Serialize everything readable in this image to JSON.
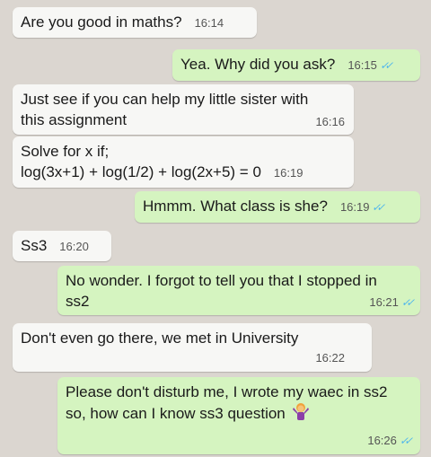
{
  "messages": [
    {
      "id": "m1",
      "direction": "incoming",
      "text": "Are you good in maths?",
      "time": "16:14"
    },
    {
      "id": "m2",
      "direction": "outgoing",
      "text": "Yea. Why did you ask?",
      "time": "16:15",
      "status": "read"
    },
    {
      "id": "m3",
      "direction": "incoming",
      "text": "Just see if you can help my little sister with this assignment",
      "time": "16:16"
    },
    {
      "id": "m4",
      "direction": "incoming",
      "line1": "Solve for x if;",
      "line2": "log(3x+1) + log(1/2) + log(2x+5) = 0",
      "time": "16:19"
    },
    {
      "id": "m5",
      "direction": "outgoing",
      "text": "Hmmm. What class is she?",
      "time": "16:19",
      "status": "read"
    },
    {
      "id": "m6",
      "direction": "incoming",
      "text": "Ss3",
      "time": "16:20"
    },
    {
      "id": "m7",
      "direction": "outgoing",
      "text": "No wonder. I forgot to tell you that I stopped in ss2",
      "time": "16:21",
      "status": "read"
    },
    {
      "id": "m8",
      "direction": "incoming",
      "text": "Don't even go there, we met in University",
      "time": "16:22"
    },
    {
      "id": "m9",
      "direction": "outgoing",
      "text": "Please don't disturb me,  I wrote my waec in ss2 so, how can I know ss3 question",
      "emoji": "woman-shrugging-emoji",
      "time": "16:26",
      "status": "read"
    }
  ],
  "colors": {
    "background": "#dbd6d0",
    "incoming_bubble": "#f7f7f5",
    "outgoing_bubble": "#d5f4c0",
    "read_ticks": "#4fb6ec"
  },
  "icons": {
    "read_status": "double-check-icon"
  },
  "tick_glyph": "✓✓"
}
